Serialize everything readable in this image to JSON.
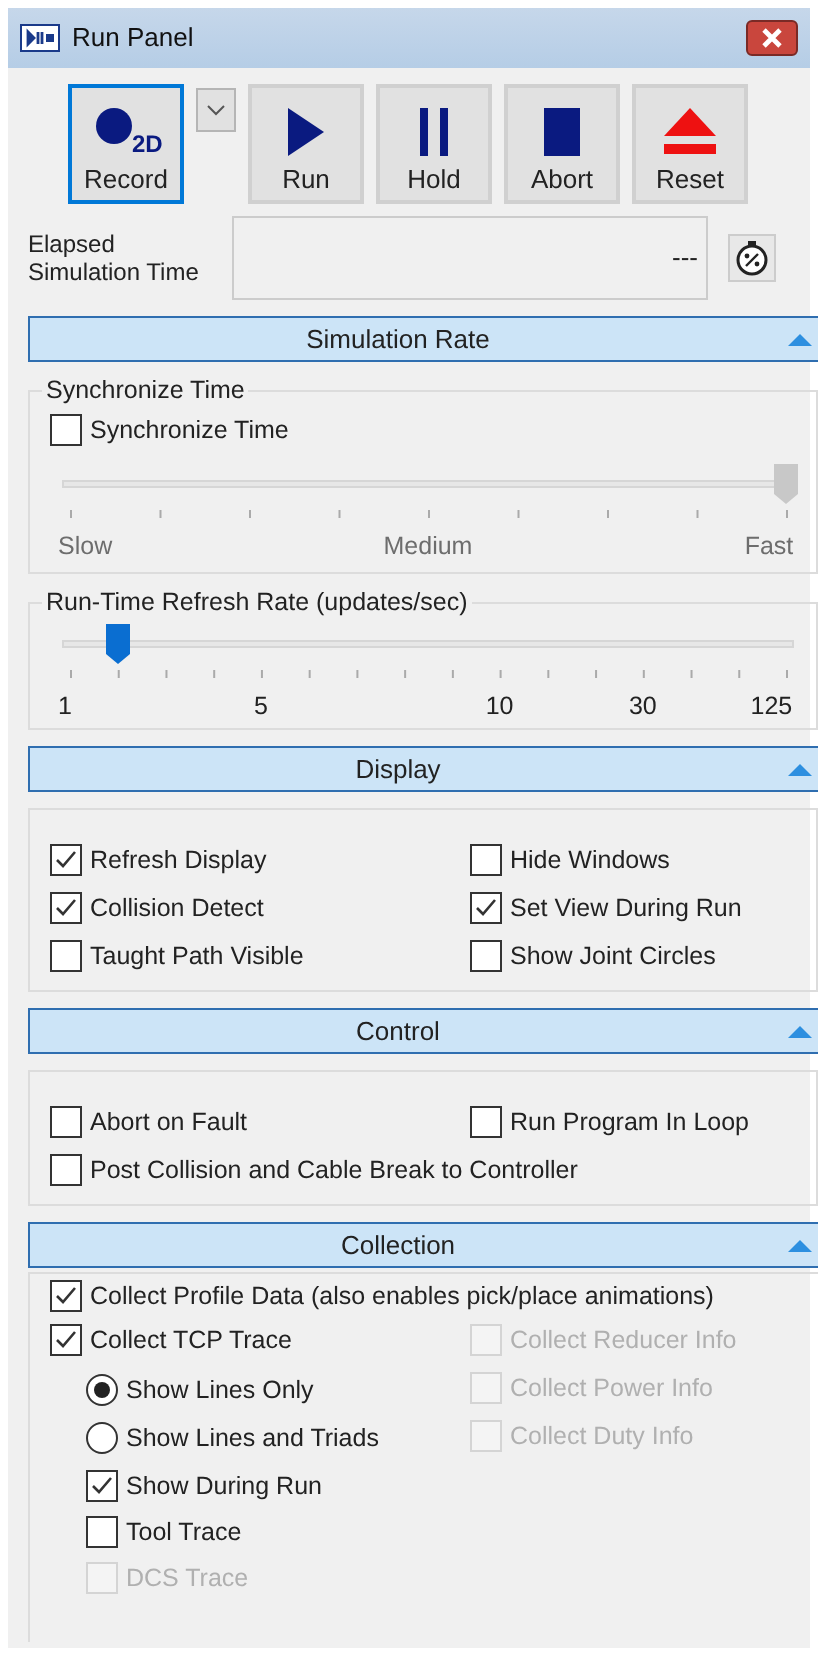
{
  "window": {
    "title": "Run Panel"
  },
  "toolbar": [
    {
      "kind": "record",
      "label": "Record",
      "badge": "2D",
      "focused": true
    },
    {
      "kind": "dropdown",
      "focused": false
    },
    {
      "kind": "run",
      "label": "Run",
      "focused": false
    },
    {
      "kind": "hold",
      "label": "Hold",
      "focused": false
    },
    {
      "kind": "abort",
      "label": "Abort",
      "focused": false
    },
    {
      "kind": "reset",
      "label": "Reset",
      "focused": false
    }
  ],
  "elapsed": {
    "label": "Elapsed Simulation Time",
    "value": "---"
  },
  "sections": [
    {
      "kind": "rate",
      "title": "Simulation Rate",
      "expanded": true,
      "sync_group": {
        "title": "Synchronize Time",
        "checkbox": {
          "label": "Synchronize Time",
          "checked": false
        },
        "slider": {
          "level": 1.0,
          "disabled": true,
          "labels": [
            "Slow",
            "Medium",
            "Fast"
          ]
        }
      },
      "refresh_group": {
        "title": "Run-Time Refresh Rate (updates/sec)",
        "slider": {
          "level": 0.067,
          "disabled": false,
          "labels": [
            "1",
            "5",
            "10",
            "30",
            "125"
          ]
        }
      }
    },
    {
      "kind": "grid",
      "title": "Display",
      "expanded": true,
      "items": [
        {
          "label": "Refresh Display",
          "checked": true,
          "disabled": false
        },
        {
          "label": "Hide Windows",
          "checked": false,
          "disabled": false
        },
        {
          "label": "Collision Detect",
          "checked": true,
          "disabled": false
        },
        {
          "label": "Set View During Run",
          "checked": true,
          "disabled": false
        },
        {
          "label": "Taught Path Visible",
          "checked": false,
          "disabled": false
        },
        {
          "label": "Show Joint Circles",
          "checked": false,
          "disabled": false
        }
      ]
    },
    {
      "kind": "grid",
      "title": "Control",
      "expanded": true,
      "items": [
        {
          "label": "Abort on Fault",
          "checked": false,
          "disabled": false
        },
        {
          "label": "Run Program In Loop",
          "checked": false,
          "disabled": false
        }
      ],
      "wide_items": [
        {
          "label": "Post Collision and Cable Break to Controller",
          "checked": false,
          "disabled": false
        }
      ]
    },
    {
      "kind": "collection",
      "title": "Collection",
      "expanded": true,
      "legend_check": {
        "label": "Collect Profile Data (also enables pick/place animations)",
        "checked": true
      },
      "left": [
        {
          "kind": "checkbox",
          "label": "Collect TCP Trace",
          "checked": true,
          "disabled": false,
          "children": [
            {
              "kind": "radio",
              "label": "Show Lines Only",
              "selected": true,
              "disabled": false
            },
            {
              "kind": "radio",
              "label": "Show Lines and Triads",
              "selected": false,
              "disabled": false
            },
            {
              "kind": "checkbox",
              "label": "Show During Run",
              "checked": true,
              "disabled": false
            },
            {
              "kind": "checkbox",
              "label": "Tool Trace",
              "checked": false,
              "disabled": false
            },
            {
              "kind": "checkbox",
              "label": "DCS Trace",
              "checked": false,
              "disabled": true
            }
          ]
        }
      ],
      "right": [
        {
          "kind": "checkbox",
          "label": "Collect Reducer Info",
          "checked": false,
          "disabled": true
        },
        {
          "kind": "checkbox",
          "label": "Collect Power Info",
          "checked": false,
          "disabled": true
        },
        {
          "kind": "checkbox",
          "label": "Collect Duty Info",
          "checked": false,
          "disabled": true
        }
      ]
    }
  ]
}
